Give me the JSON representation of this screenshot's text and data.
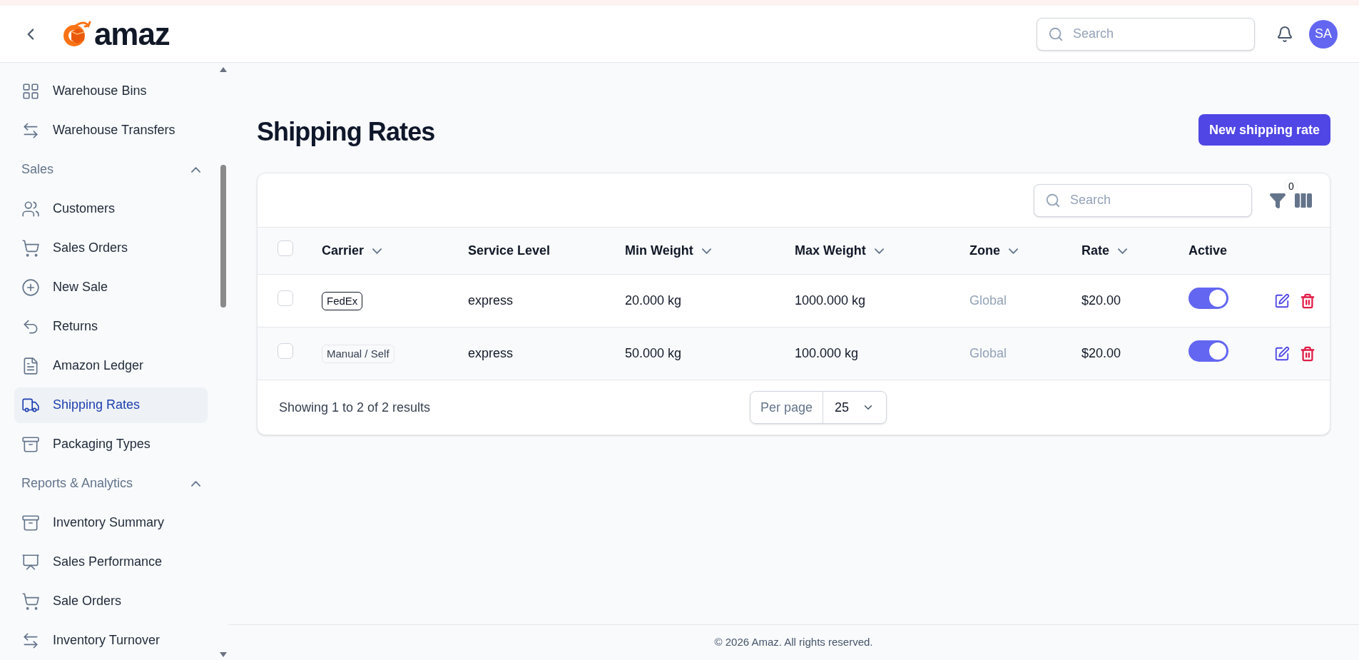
{
  "header": {
    "logo_text": "amaz",
    "search": {
      "placeholder": "Search"
    },
    "avatar": "SA"
  },
  "sidebar": {
    "items": [
      {
        "kind": "item",
        "label": "Warehouse Bins",
        "selected": false
      },
      {
        "kind": "item",
        "label": "Warehouse Transfers",
        "selected": false
      },
      {
        "kind": "section",
        "label": "Sales",
        "expanded": true
      },
      {
        "kind": "item",
        "label": "Customers",
        "selected": false
      },
      {
        "kind": "item",
        "label": "Sales Orders",
        "selected": false
      },
      {
        "kind": "item",
        "label": "New Sale",
        "selected": false
      },
      {
        "kind": "item",
        "label": "Returns",
        "selected": false
      },
      {
        "kind": "item",
        "label": "Amazon Ledger",
        "selected": false
      },
      {
        "kind": "item",
        "label": "Shipping Rates",
        "selected": true
      },
      {
        "kind": "item",
        "label": "Packaging Types",
        "selected": false
      },
      {
        "kind": "section",
        "label": "Reports & Analytics",
        "expanded": true
      },
      {
        "kind": "item",
        "label": "Inventory Summary",
        "selected": false
      },
      {
        "kind": "item",
        "label": "Sales Performance",
        "selected": false
      },
      {
        "kind": "item",
        "label": "Sale Orders",
        "selected": false
      },
      {
        "kind": "item",
        "label": "Inventory Turnover",
        "selected": false
      }
    ]
  },
  "page": {
    "title": "Shipping Rates",
    "primary_button": "New shipping rate"
  },
  "table": {
    "search": {
      "placeholder": "Search"
    },
    "filter_count": "0",
    "select_all_checked": false,
    "columns": [
      {
        "label": "Carrier",
        "sortable": true
      },
      {
        "label": "Service Level",
        "sortable": false
      },
      {
        "label": "Min Weight",
        "sortable": true
      },
      {
        "label": "Max Weight",
        "sortable": true
      },
      {
        "label": "Zone",
        "sortable": true
      },
      {
        "label": "Rate",
        "sortable": true
      },
      {
        "label": "Active",
        "sortable": false
      }
    ],
    "rows": [
      {
        "checked": false,
        "carrier": {
          "label": "FedEx",
          "kind": "outlined"
        },
        "service_level": "express",
        "min_weight": "20.000 kg",
        "max_weight": "1000.000 kg",
        "zone": "Global",
        "rate": "$20.00",
        "active": true
      },
      {
        "checked": false,
        "carrier": {
          "label": "Manual / Self",
          "kind": "muted"
        },
        "service_level": "express",
        "min_weight": "50.000 kg",
        "max_weight": "100.000 kg",
        "zone": "Global",
        "rate": "$20.00",
        "active": true
      }
    ],
    "summary": "Showing 1 to 2 of 2 results",
    "per_page_label": "Per page",
    "per_page_value": "25"
  },
  "footer": "© 2026 Amaz. All rights reserved."
}
